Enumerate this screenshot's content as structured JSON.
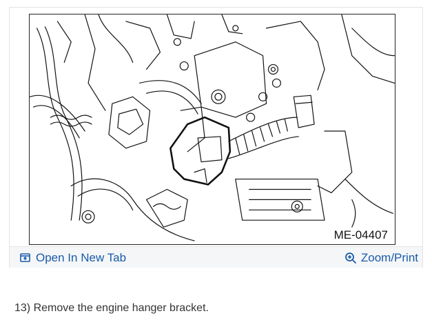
{
  "figure": {
    "code": "ME-04407",
    "icon": "mechanical-diagram"
  },
  "toolbar": {
    "open_label": "Open In New Tab",
    "open_icon": "open-new-tab-icon",
    "zoom_label": "Zoom/Print",
    "zoom_icon": "magnifier-plus-icon",
    "link_color": "#1a5aa8"
  },
  "instruction": {
    "text": "13) Remove the engine hanger bracket."
  }
}
